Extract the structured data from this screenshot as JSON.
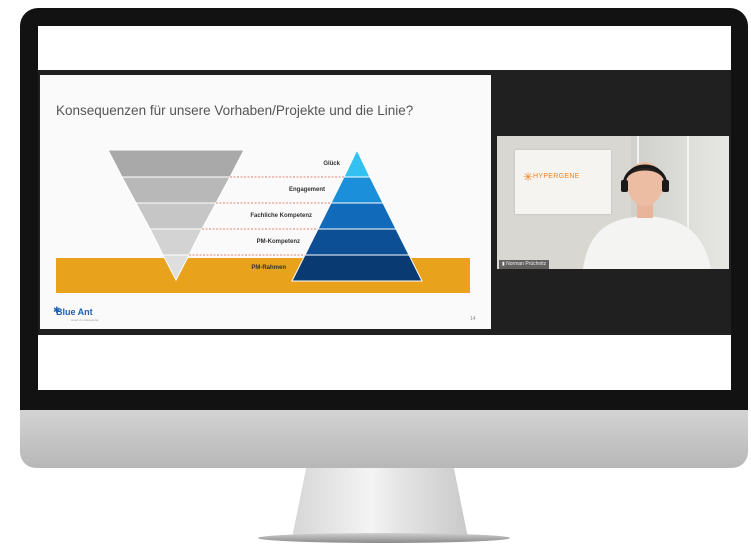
{
  "slide": {
    "title": "Konsequenzen für unsere Vorhaben/Projekte und die Linie?",
    "pyramid_levels": [
      "Glück",
      "Engagement",
      "Fachliche Kompetenz",
      "PM-Kompetenz",
      "PM-Rahmen"
    ],
    "brand": "Blue Ant",
    "brand_tagline": "smart & professional",
    "page_number": "14",
    "colors": {
      "band": "#e8a21c",
      "funnel": [
        "#a9a9a9",
        "#b8b8b8",
        "#c6c6c6",
        "#d3d3d3",
        "#dedede"
      ],
      "pyramid": [
        "#33c1f2",
        "#1b8fd9",
        "#126bba",
        "#0d4f95",
        "#0a3a72"
      ]
    }
  },
  "video": {
    "wall_sign": "HYPERGENE",
    "participant_name": "Norman Prüchnitz"
  }
}
